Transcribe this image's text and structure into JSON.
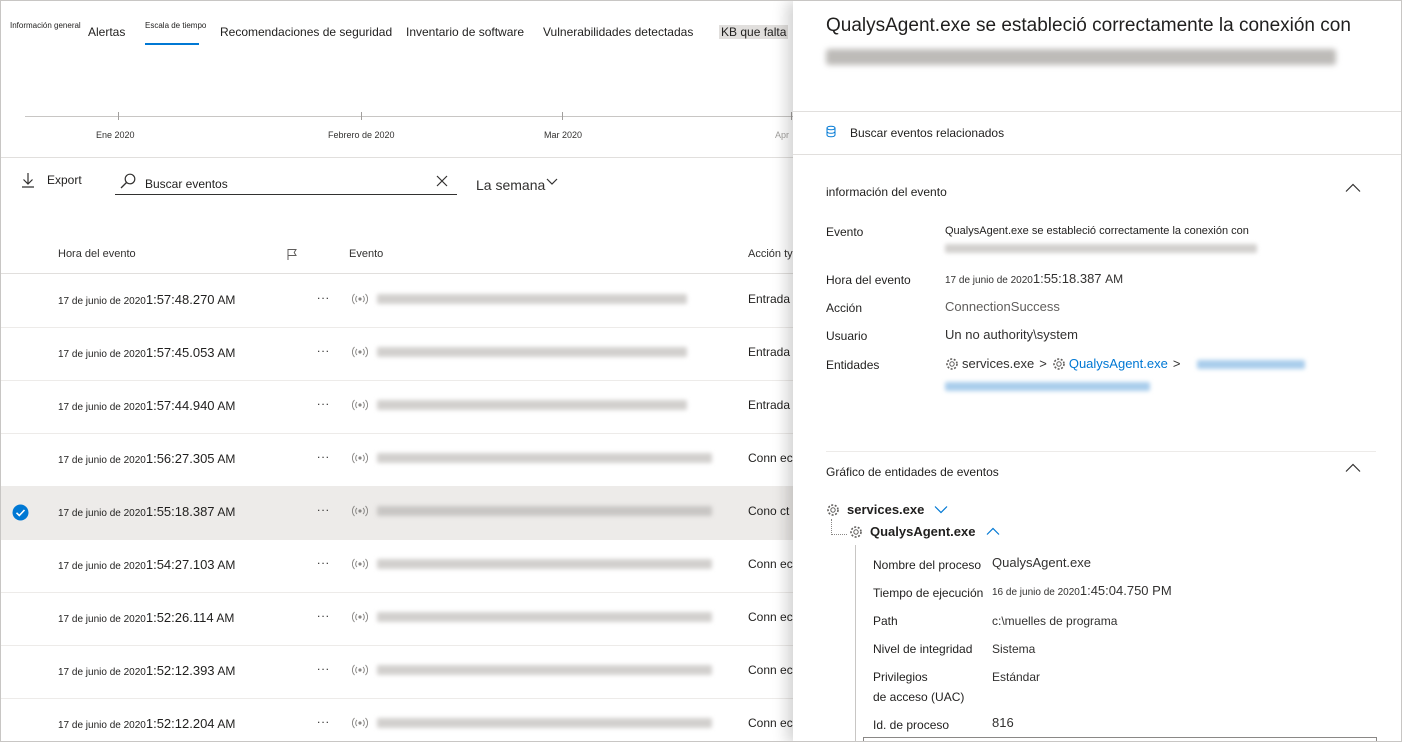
{
  "tabs": [
    {
      "label": "Información general"
    },
    {
      "label": "Alertas"
    },
    {
      "label": "Escala de tiempo"
    },
    {
      "label": "Recomendaciones de seguridad"
    },
    {
      "label": "Inventario de software"
    },
    {
      "label": "Vulnerabilidades detectadas"
    },
    {
      "label": "KB que falta"
    }
  ],
  "timeline": {
    "months": [
      "Ene 2020",
      "Febrero de 2020",
      "Mar 2020",
      "Apr"
    ]
  },
  "toolbar": {
    "export_label": "Export",
    "search_value": "Buscar eventos",
    "period_label": "La semana"
  },
  "columns": {
    "time": "Hora del evento",
    "event": "Evento",
    "action": "Acción ty"
  },
  "rows": [
    {
      "date": "17 de junio de 2020",
      "time": "1:57:48.270",
      "ampm": "AM",
      "action": "Entrada"
    },
    {
      "date": "17 de junio de 2020",
      "time": "1:57:45.053",
      "ampm": "AM",
      "action": "Entrada"
    },
    {
      "date": "17 de junio de 2020",
      "time": "1:57:44.940",
      "ampm": "AM",
      "action": "Entrada"
    },
    {
      "date": "17 de junio de 2020",
      "time": "1:56:27.305",
      "ampm": "AM",
      "action": "Conn ect"
    },
    {
      "date": "17 de junio de 2020",
      "time": "1:55:18.387",
      "ampm": "AM",
      "action": "Cono ct"
    },
    {
      "date": "17 de junio de 2020",
      "time": "1:54:27.103",
      "ampm": "AM",
      "action": "Conn ect"
    },
    {
      "date": "17 de junio de 2020",
      "time": "1:52:26.114",
      "ampm": "AM",
      "action": "Conn ect"
    },
    {
      "date": "17 de junio de 2020",
      "time": "1:52:12.393",
      "ampm": "AM",
      "action": "Conn ect"
    },
    {
      "date": "17 de junio de 2020",
      "time": "1:52:12.204",
      "ampm": "AM",
      "action": "Conn ect"
    }
  ],
  "panel": {
    "title": "QualysAgent.exe se estableció correctamente la conexión con",
    "related_events": "Buscar eventos relacionados",
    "event_info": {
      "header": "información del evento",
      "event_label": "Evento",
      "event_value": "QualysAgent.exe se estableció correctamente la conexión con",
      "time_label": "Hora del evento",
      "time_date": "17 de junio de 2020",
      "time_value": "1:55:18.387",
      "time_ampm": "AM",
      "action_label": "Acción",
      "action_value": "ConnectionSuccess",
      "user_label": "Usuario",
      "user_value": "Un no authority\\system",
      "entities_label": "Entidades",
      "entity_1": "services.exe",
      "entity_2": "QualysAgent.exe",
      "separator": ">"
    },
    "graph": {
      "header": "Gráfico de entidades de eventos",
      "root": "services.exe",
      "child": "QualysAgent.exe",
      "props": {
        "process_name_label": "Nombre del proceso",
        "process_name_value": "QualysAgent.exe",
        "exec_time_label": "Tiempo de ejecución",
        "exec_time_date": "16 de junio de 2020",
        "exec_time_value": "1:45:04.750 PM",
        "path_label": "Path",
        "path_value": "c:\\muelles de programa",
        "integrity_label": "Nivel de integridad",
        "integrity_value": "Sistema",
        "privileges_label_1": "Privilegios",
        "privileges_label_2": "de acceso (UAC)",
        "privileges_value": "Estándar",
        "pid_label": "Id. de proceso",
        "pid_value": "816"
      }
    }
  },
  "colors": {
    "accent": "#0078d4",
    "selected_row": "#edebe9",
    "divider": "#e1dfdd"
  }
}
